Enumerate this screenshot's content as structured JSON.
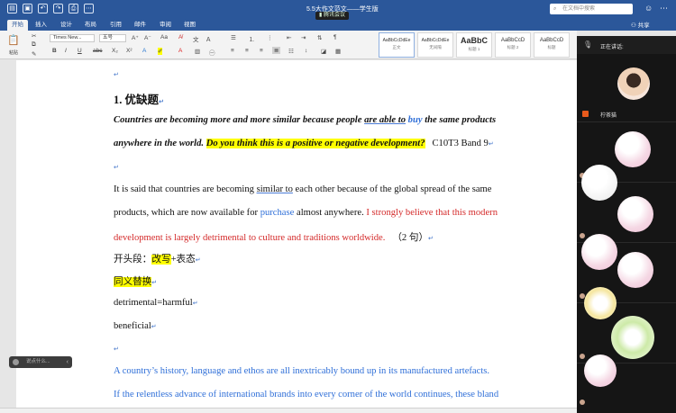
{
  "window": {
    "title": "5.5大作文范文——学生版",
    "meeting_label": "腾讯会议",
    "search_placeholder": "在文档中搜索"
  },
  "tabs": [
    "开始",
    "插入",
    "设计",
    "布局",
    "引用",
    "邮件",
    "审阅",
    "视图"
  ],
  "share_label": "共享",
  "ribbon": {
    "paste_label": "粘贴",
    "font_name": "Times New...",
    "font_size": "五号",
    "styles": [
      {
        "sample": "AaBbCcDdEe",
        "name": "正文"
      },
      {
        "sample": "AaBbCcDdEe",
        "name": "无间隔"
      },
      {
        "sample": "AaBbC",
        "name": "标题 1"
      },
      {
        "sample": "AaBbCcD",
        "name": "标题 2"
      },
      {
        "sample": "AaBbCcD",
        "name": "标题"
      }
    ]
  },
  "document": {
    "mark": "↵",
    "heading": "1. 优缺题",
    "prompt_part1": "Countries are becoming more and more similar because people ",
    "prompt_part2": "are able to",
    "prompt_part3": " ",
    "prompt_part4": "buy",
    "prompt_part5": " the same products",
    "prompt_line2_a": "anywhere in the world. ",
    "prompt_question": "Do you think this is a positive or negative development?",
    "prompt_ref": "C10T3 Band 9",
    "p1_a": "It is said that countries are becoming ",
    "p1_similar": "similar to",
    "p1_b": " each other because of the global spread of the same",
    "p2_a": "products, which are now available for ",
    "p2_purchase": "purchase",
    "p2_b": " almost anywhere. ",
    "p2_red": "I strongly believe that this modern",
    "p3_red": "development is largely detrimental to culture and traditions worldwide.",
    "p3_count": "（2 句）",
    "opening_a": "开头段：",
    "opening_hl": "改写",
    "opening_b": "+表态",
    "synonym_hl": "同义替换",
    "word1": "detrimental=harmful",
    "word2": "beneficial",
    "blue1": "A country’s history, language and ethos are all inextricably bound up in its manufactured artefacts.",
    "blue2": "If the relentless advance of international brands into every corner of the world continues, these bland"
  },
  "meeting_panel": {
    "speaking_label": "正在讲话:",
    "speaker_name": "柠茶猫"
  },
  "voice_prompt": "说点什么..."
}
